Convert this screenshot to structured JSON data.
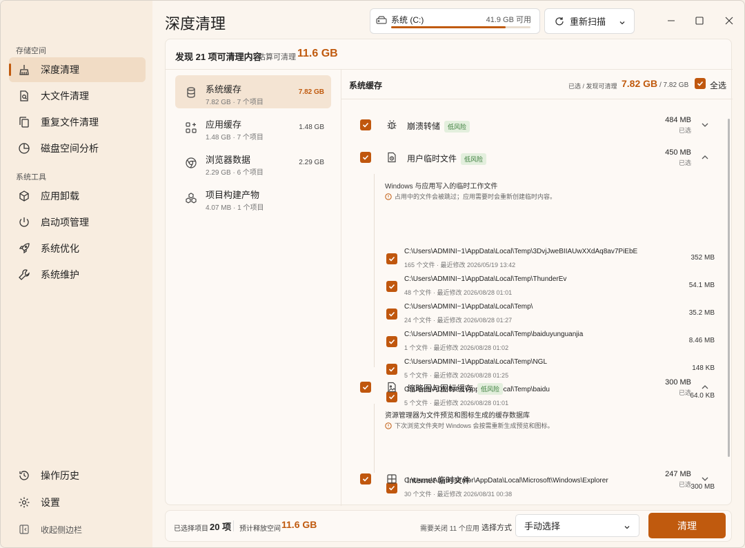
{
  "app": {
    "title": "深度清理"
  },
  "drive": {
    "name": "系统 (C:)",
    "free": "41.9 GB 可用",
    "used_fraction": 0.82
  },
  "rescan": {
    "label": "重新扫描"
  },
  "sidebar": {
    "storage_label": "存储空间",
    "tools_label": "系统工具",
    "items": [
      {
        "label": "深度清理",
        "icon": "broom-icon"
      },
      {
        "label": "大文件清理",
        "icon": "file-search-icon"
      },
      {
        "label": "重复文件清理",
        "icon": "copy-icon"
      },
      {
        "label": "磁盘空间分析",
        "icon": "pie-chart-icon"
      },
      {
        "label": "应用卸载",
        "icon": "package-icon"
      },
      {
        "label": "启动项管理",
        "icon": "power-icon"
      },
      {
        "label": "系统优化",
        "icon": "rocket-icon"
      },
      {
        "label": "系统维护",
        "icon": "wrench-icon"
      }
    ],
    "history": "操作历史",
    "settings": "设置",
    "collapse": "收起侧边栏"
  },
  "summary": {
    "found": "发现 21 项可清理内容",
    "estimate_label": "估算可清理",
    "estimate_value": "11.6 GB"
  },
  "categories": [
    {
      "name": "系统缓存",
      "sub": "7.82 GB · 7 个项目",
      "size": "7.82 GB"
    },
    {
      "name": "应用缓存",
      "sub": "1.48 GB · 7 个项目",
      "size": "1.48 GB"
    },
    {
      "name": "浏览器数据",
      "sub": "2.29 GB · 6 个项目",
      "size": "2.29 GB"
    },
    {
      "name": "项目构建产物",
      "sub": "4.07 MB · 1 个项目",
      "size": ""
    }
  ],
  "detail": {
    "title": "系统缓存",
    "sel_label": "已选 / 发现可清理",
    "sel_value": "7.82 GB",
    "total": "/ 7.82 GB",
    "select_all": "全选",
    "groups": [
      {
        "name": "崩溃转储",
        "badge": "低风险",
        "size": "484 MB",
        "sel": "已选"
      },
      {
        "name": "用户临时文件",
        "badge": "低风险",
        "size": "450 MB",
        "sel": "已选",
        "desc": "Windows 与应用写入的临时工作文件",
        "warn": "占用中的文件会被跳过；应用需要时会重新创建临时内容。",
        "items": [
          {
            "path": "C:\\Users\\ADMINI~1\\AppData\\Local\\Temp\\3DvjJweBIIAUwXXdAq8av7PiEbE",
            "meta": "165 个文件 · 最近修改 2026/05/19 13:42",
            "size": "352 MB"
          },
          {
            "path": "C:\\Users\\ADMINI~1\\AppData\\Local\\Temp\\ThunderEv",
            "meta": "48 个文件 · 最近修改 2026/08/28 01:01",
            "size": "54.1 MB"
          },
          {
            "path": "C:\\Users\\ADMINI~1\\AppData\\Local\\Temp\\",
            "meta": "24 个文件 · 最近修改 2026/08/28 01:27",
            "size": "35.2 MB"
          },
          {
            "path": "C:\\Users\\ADMINI~1\\AppData\\Local\\Temp\\baiduyunguanjia",
            "meta": "1 个文件 · 最近修改 2026/08/28 01:02",
            "size": "8.46 MB"
          },
          {
            "path": "C:\\Users\\ADMINI~1\\AppData\\Local\\Temp\\NGL",
            "meta": "5 个文件 · 最近修改 2026/08/28 01:25",
            "size": "148 KB"
          },
          {
            "path": "C:\\Users\\ADMINI~1\\AppData\\Local\\Temp\\baidu",
            "meta": "5 个文件 · 最近修改 2026/08/28 01:01",
            "size": "64.0 KB"
          }
        ]
      },
      {
        "name": "缩略图与图标缓存",
        "badge": "低风险",
        "size": "300 MB",
        "sel": "已选",
        "desc": "资源管理器为文件预览和图标生成的缓存数据库",
        "warn": "下次浏览文件夹时 Windows 会按需重新生成预览和图标。",
        "items": [
          {
            "path": "C:\\Users\\Administrator\\AppData\\Local\\Microsoft\\Windows\\Explorer",
            "meta": "30 个文件 · 最近修改 2026/08/31 00:38",
            "size": "300 MB"
          }
        ]
      },
      {
        "name": "Internet 临时文件",
        "badge": "",
        "size": "247 MB",
        "sel": "已选"
      }
    ]
  },
  "footer": {
    "selected_label": "已选择项目",
    "selected_value": "20 项",
    "free_label": "预计释放空间",
    "free_value": "11.6 GB",
    "close_apps": "需要关闭 11 个应用",
    "mode_label": "选择方式",
    "mode_value": "手动选择",
    "clean": "清理"
  }
}
